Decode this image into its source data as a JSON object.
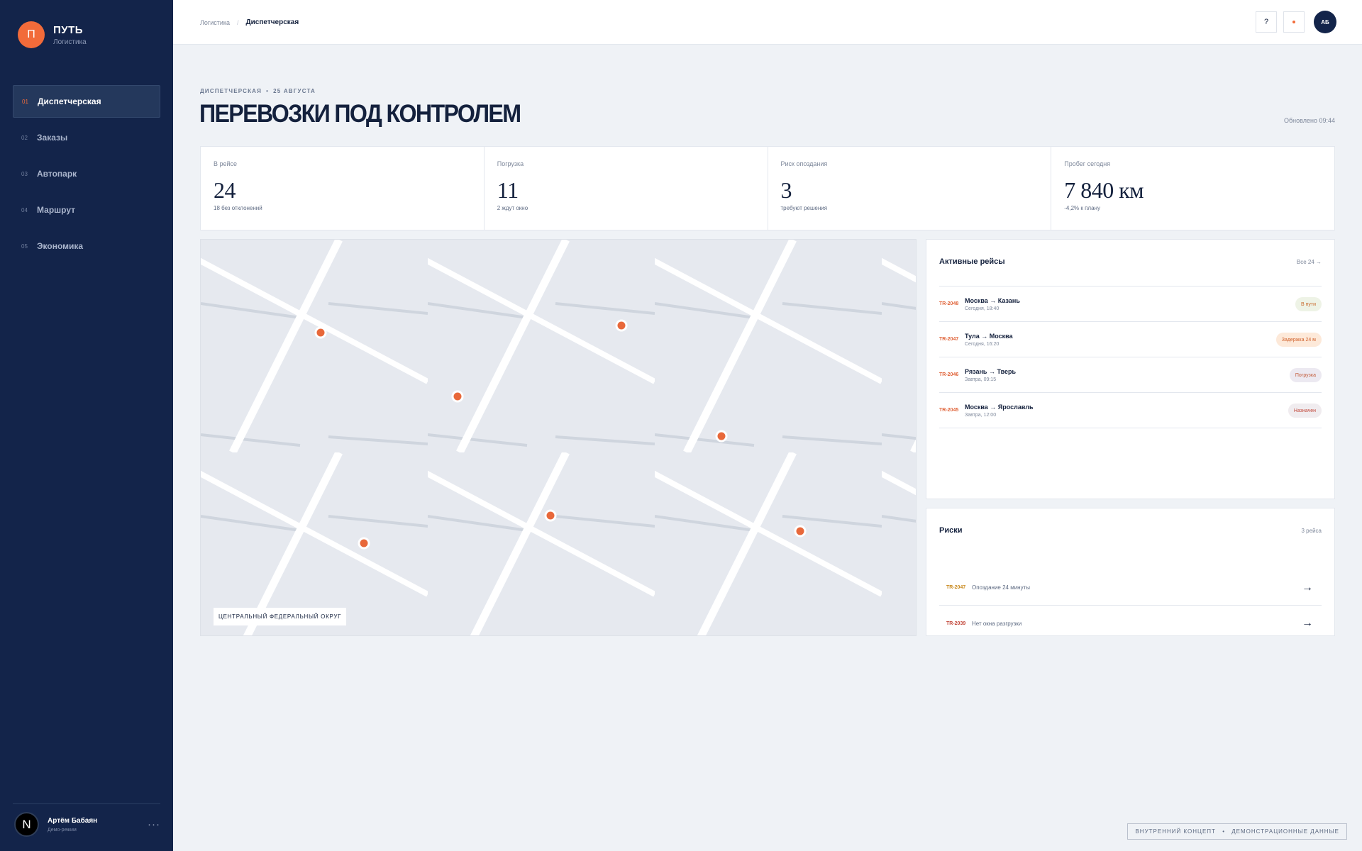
{
  "brand": {
    "logo_letter": "П",
    "name": "ПУТЬ",
    "subtitle": "Логистика"
  },
  "nav": [
    {
      "num": "01",
      "label": "Диспетчерская",
      "active": true
    },
    {
      "num": "02",
      "label": "Заказы"
    },
    {
      "num": "03",
      "label": "Автопарк"
    },
    {
      "num": "04",
      "label": "Маршрут"
    },
    {
      "num": "05",
      "label": "Экономика"
    }
  ],
  "user": {
    "avatar_letter": "N",
    "name": "Артём Бабаян",
    "role": "Демо-режим",
    "more": "···"
  },
  "topbar": {
    "breadcrumb_parent": "Логистика",
    "breadcrumb_sep": "/",
    "breadcrumb_current": "Диспетчерская",
    "help": "?",
    "avatar_initials": "АБ"
  },
  "header": {
    "eyebrow_section": "ДИСПЕТЧЕРСКАЯ",
    "eyebrow_dot": "•",
    "eyebrow_date": "25 АВГУСТА",
    "title": "ПЕРЕВОЗКИ ПОД КОНТРОЛЕМ",
    "updated": "Обновлено 09:44"
  },
  "kpis": [
    {
      "label": "В рейсе",
      "value": "24",
      "sub": "18 без отклонений"
    },
    {
      "label": "Погрузка",
      "value": "11",
      "sub": "2 ждут окно"
    },
    {
      "label": "Риск опоздания",
      "value": "3",
      "sub": "требуют решения"
    },
    {
      "label": "Пробег сегодня",
      "value": "7 840 км",
      "sub": "-4,2% к плану"
    }
  ],
  "map": {
    "region_label": "ЦЕНТРАЛЬНЫЙ ФЕДЕРАЛЬНЫЙ ОКРУГ",
    "marker_color": "#e8683a",
    "marker_count": 7
  },
  "trips": {
    "title": "Активные рейсы",
    "link": "Все 24 →",
    "items": [
      {
        "id": "TR-2048",
        "route": "Москва → Казань",
        "time": "Сегодня, 18:40",
        "status": "В пути",
        "status_bg": "#eef3e6",
        "status_color": "#c86a2e"
      },
      {
        "id": "TR-2047",
        "route": "Тула → Москва",
        "time": "Сегодня, 16:20",
        "status": "Задержка 24 м",
        "status_bg": "#fde9d9",
        "status_color": "#d0602a"
      },
      {
        "id": "TR-2046",
        "route": "Рязань → Тверь",
        "time": "Завтра, 09:15",
        "status": "Погрузка",
        "status_bg": "#ece9f1",
        "status_color": "#c25a38"
      },
      {
        "id": "TR-2045",
        "route": "Москва → Ярославль",
        "time": "Завтра, 12:00",
        "status": "Назначен",
        "status_bg": "#f0ecef",
        "status_color": "#c2473a"
      }
    ]
  },
  "risks": {
    "title": "Риски",
    "count": "3 рейса",
    "items": [
      {
        "id": "TR-2047",
        "text": "Опоздание 24 минуты",
        "id_color": "#c98a1f",
        "arrow": "→"
      },
      {
        "id": "TR-2039",
        "text": "Нет окна разгрузки",
        "id_color": "#c2473a",
        "arrow": "→"
      }
    ]
  },
  "footer": {
    "left": "ВНУТРЕННИЙ КОНЦЕПТ",
    "dot": "•",
    "right": "ДЕМОНСТРАЦИОННЫЕ ДАННЫЕ"
  }
}
